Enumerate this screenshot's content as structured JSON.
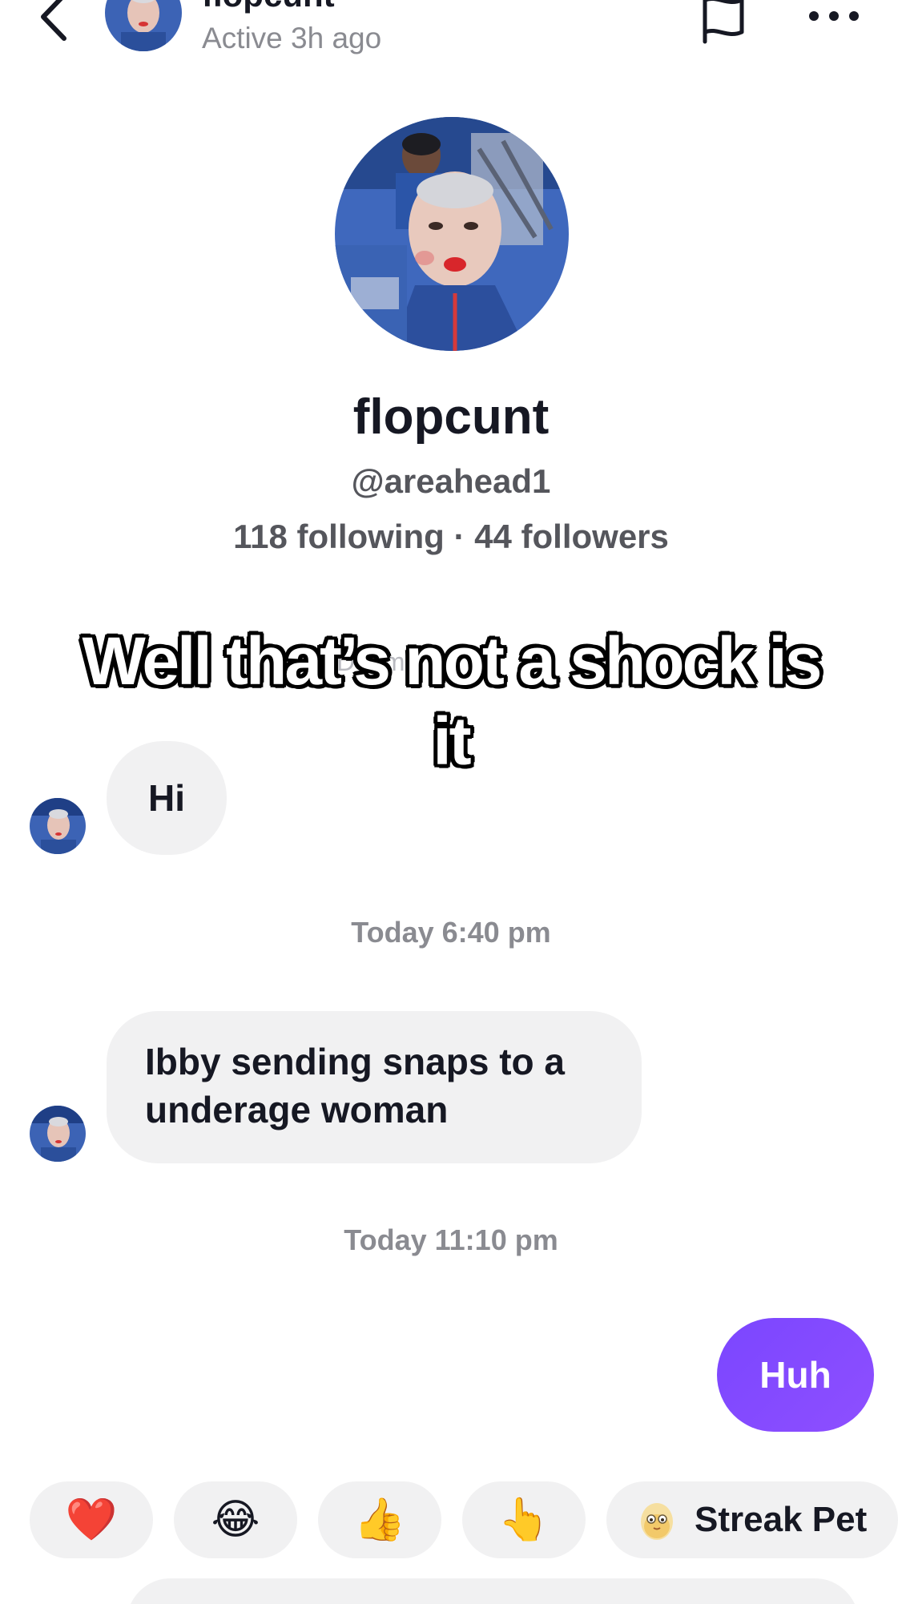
{
  "header": {
    "name": "flopcunt",
    "status": "Active 3h ago",
    "back_icon": "chevron-left-icon",
    "report_icon": "flag-icon",
    "more_icon": "more-horizontal-icon"
  },
  "profile": {
    "display_name": "flopcunt",
    "handle": "@areahead1",
    "stats": "118 following · 44 followers"
  },
  "overlay": {
    "caption": "Well that’s not a shock is it",
    "faint_text": "D   a   m"
  },
  "messages": [
    {
      "direction": "incoming",
      "text": "Hi"
    },
    {
      "type": "timestamp",
      "text": "Today 6:40 pm"
    },
    {
      "direction": "incoming",
      "text": "Ibby sending snaps to a underage woman"
    },
    {
      "type": "timestamp",
      "text": "Today 11:10 pm"
    },
    {
      "direction": "outgoing",
      "text": "Huh"
    }
  ],
  "reactions": [
    {
      "emoji": "❤️",
      "icon": "heart-icon"
    },
    {
      "emoji": "😂",
      "icon": "laughing-tears-icon"
    },
    {
      "emoji": "👍",
      "icon": "thumbs-up-icon"
    },
    {
      "emoji": "👆",
      "icon": "pointing-up-icon"
    },
    {
      "label": "Streak Pet",
      "icon": "egg-icon"
    }
  ],
  "colors": {
    "outgoing_bubble": "#7b46ff",
    "incoming_bubble": "#f1f1f2",
    "muted_text": "#8a8b91"
  }
}
